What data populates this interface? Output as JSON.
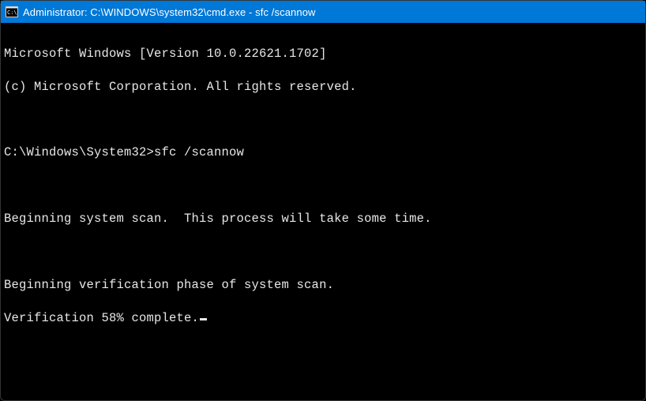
{
  "titlebar": {
    "title": "Administrator: C:\\WINDOWS\\system32\\cmd.exe - sfc  /scannow"
  },
  "terminal": {
    "lines": {
      "version": "Microsoft Windows [Version 10.0.22621.1702]",
      "copyright": "(c) Microsoft Corporation. All rights reserved.",
      "blank1": "",
      "prompt": "C:\\Windows\\System32>",
      "command": "sfc /scannow",
      "blank2": "",
      "begin_scan": "Beginning system scan.  This process will take some time.",
      "blank3": "",
      "begin_verify": "Beginning verification phase of system scan.",
      "verify_progress": "Verification 58% complete."
    }
  }
}
